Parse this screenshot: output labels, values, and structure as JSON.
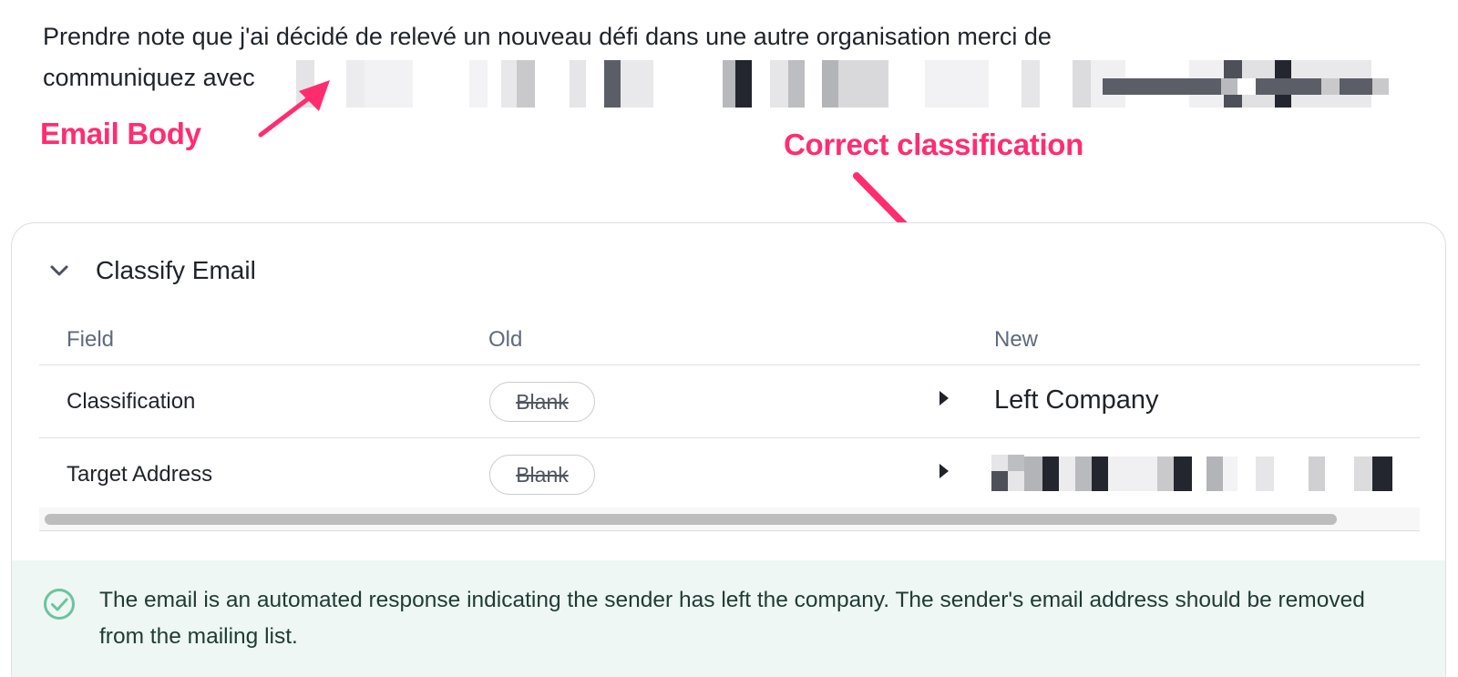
{
  "email": {
    "body_line1": "Prendre note que j'ai décidé de relevé un nouveau défi dans une autre organisation merci de",
    "body_line2": "communiquez avec"
  },
  "annotations": {
    "email_body": "Email Body",
    "correct_classification": "Correct classification"
  },
  "card": {
    "title": "Classify Email",
    "columns": [
      "Field",
      "Old",
      "New"
    ],
    "rows": [
      {
        "field": "Classification",
        "old": "Blank",
        "new": "Left Company"
      },
      {
        "field": "Target Address",
        "old": "Blank",
        "new": ""
      }
    ],
    "result_text": "The email is an automated response indicating the sender has left the company. The sender's email address should be removed from the mailing list."
  },
  "colors": {
    "annotation": "#ff2d6f",
    "success": "#6cc3a0",
    "result_bg": "#eef7f3"
  },
  "icons": [
    "chevron-down-icon",
    "triangle-right-icon",
    "check-circle-icon",
    "arrow-icon"
  ]
}
